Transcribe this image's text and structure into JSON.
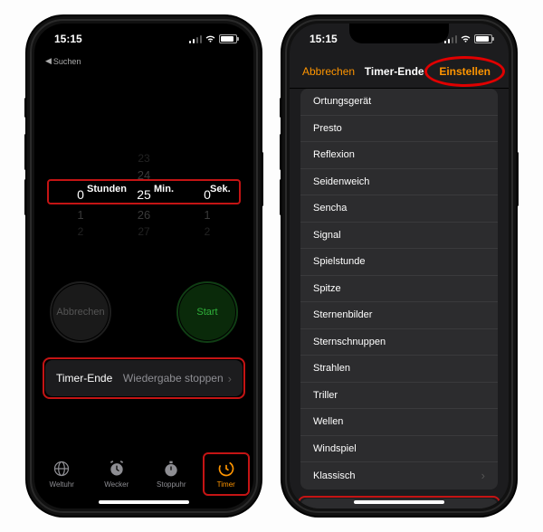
{
  "statusbar": {
    "time": "15:15"
  },
  "back_link": "Suchen",
  "picker": {
    "hours": {
      "above2": "",
      "above1": "",
      "value": "0",
      "below1": "1",
      "below2": "2",
      "unit": "Stunden"
    },
    "minutes": {
      "above2": "23",
      "above1": "24",
      "value": "25",
      "below1": "26",
      "below2": "27",
      "unit": "Min."
    },
    "seconds": {
      "above2": "",
      "above1": "",
      "value": "0",
      "below1": "1",
      "below2": "2",
      "unit": "Sek."
    }
  },
  "buttons": {
    "cancel": "Abbrechen",
    "start": "Start"
  },
  "timer_end": {
    "label": "Timer-Ende",
    "value": "Wiedergabe stoppen"
  },
  "tabs": {
    "weltuhr": "Weltuhr",
    "wecker": "Wecker",
    "stoppuhr": "Stoppuhr",
    "timer": "Timer"
  },
  "nav": {
    "cancel": "Abbrechen",
    "title": "Timer-Ende",
    "set": "Einstellen"
  },
  "sounds": [
    "Ortungsgerät",
    "Presto",
    "Reflexion",
    "Seidenweich",
    "Sencha",
    "Signal",
    "Spielstunde",
    "Spitze",
    "Sternenbilder",
    "Sternschnuppen",
    "Strahlen",
    "Triller",
    "Wellen",
    "Windspiel"
  ],
  "klassisch": "Klassisch",
  "stop_playback": "Wiedergabe stoppen"
}
